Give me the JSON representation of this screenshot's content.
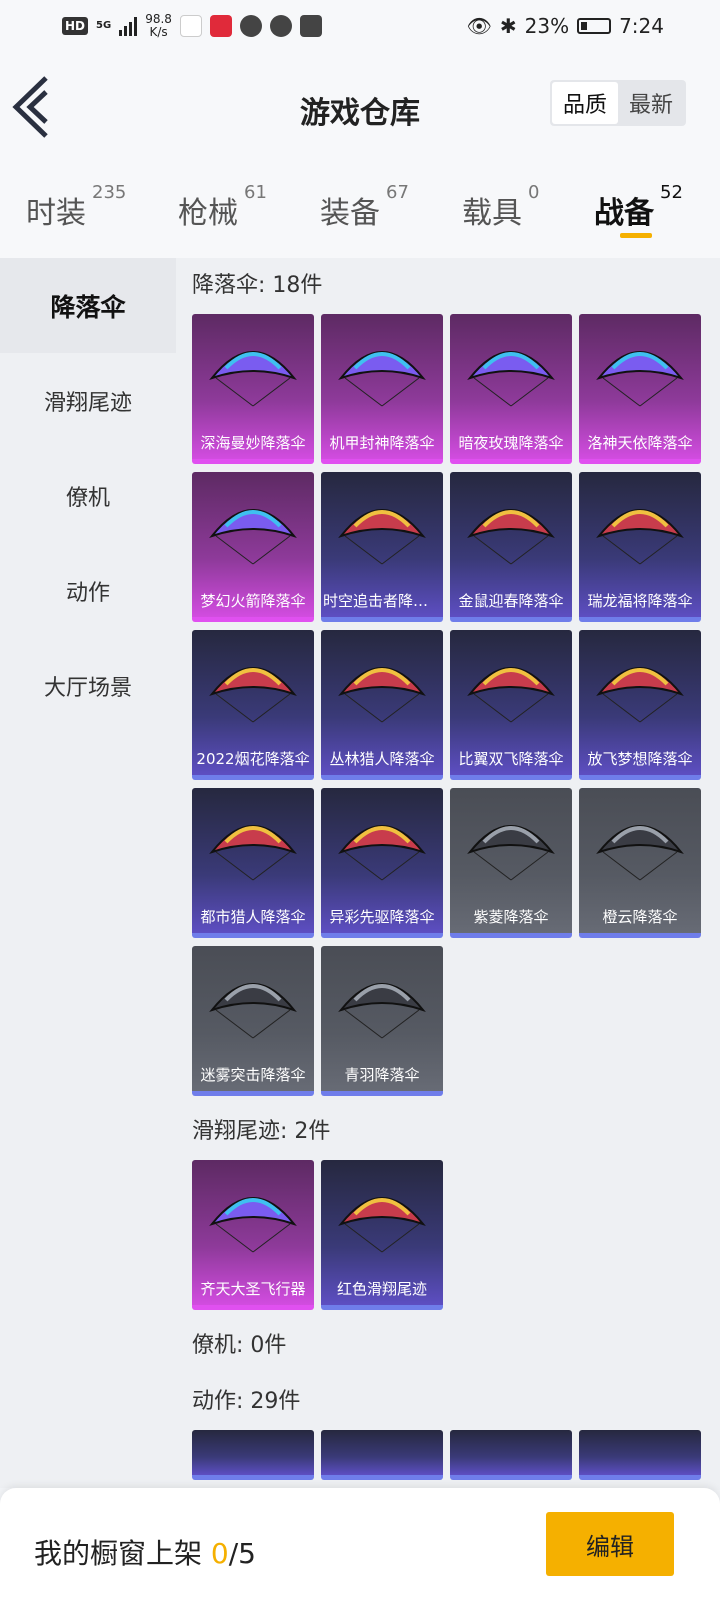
{
  "status_bar": {
    "hd": "HD",
    "network": "5G",
    "speed_value": "98.8",
    "speed_unit": "K/s",
    "battery": "23%",
    "time": "7:24"
  },
  "header": {
    "title": "游戏仓库",
    "sort_options": [
      "品质",
      "最新"
    ]
  },
  "tabs": [
    {
      "label": "时装",
      "count": "235"
    },
    {
      "label": "枪械",
      "count": "61"
    },
    {
      "label": "装备",
      "count": "67"
    },
    {
      "label": "载具",
      "count": "0"
    },
    {
      "label": "战备",
      "count": "52"
    }
  ],
  "sidebar": {
    "items": [
      "降落伞",
      "滑翔尾迹",
      "僚机",
      "动作",
      "大厅场景"
    ]
  },
  "sections": {
    "parachute": {
      "title": "降落伞: 18件",
      "items": [
        {
          "name": "深海曼妙降落伞",
          "rarity": "purple"
        },
        {
          "name": "机甲封神降落伞",
          "rarity": "purple"
        },
        {
          "name": "暗夜玫瑰降落伞",
          "rarity": "purple"
        },
        {
          "name": "洛神天依降落伞",
          "rarity": "purple"
        },
        {
          "name": "梦幻火箭降落伞",
          "rarity": "purple"
        },
        {
          "name": "时空追击者降落...",
          "rarity": "blue"
        },
        {
          "name": "金鼠迎春降落伞",
          "rarity": "blue"
        },
        {
          "name": "瑞龙福将降落伞",
          "rarity": "blue"
        },
        {
          "name": "2022烟花降落伞",
          "rarity": "blue"
        },
        {
          "name": "丛林猎人降落伞",
          "rarity": "blue"
        },
        {
          "name": "比翼双飞降落伞",
          "rarity": "blue"
        },
        {
          "name": "放飞梦想降落伞",
          "rarity": "blue"
        },
        {
          "name": "都市猎人降落伞",
          "rarity": "blue"
        },
        {
          "name": "异彩先驱降落伞",
          "rarity": "blue"
        },
        {
          "name": "紫菱降落伞",
          "rarity": "gray"
        },
        {
          "name": "橙云降落伞",
          "rarity": "gray"
        },
        {
          "name": "迷雾突击降落伞",
          "rarity": "gray"
        },
        {
          "name": "青羽降落伞",
          "rarity": "gray"
        }
      ]
    },
    "glide_trail": {
      "title": "滑翔尾迹: 2件",
      "items": [
        {
          "name": "齐天大圣飞行器",
          "rarity": "purple"
        },
        {
          "name": "红色滑翔尾迹",
          "rarity": "blue"
        }
      ]
    },
    "wingman": {
      "title": "僚机: 0件"
    },
    "emote": {
      "title": "动作: 29件"
    }
  },
  "bottom_bar": {
    "label": "我的橱窗上架",
    "count": "0",
    "total": "/5",
    "edit_label": "编辑"
  },
  "colors": {
    "accent": "#f5b000",
    "rarity_purple": "#e050f0",
    "rarity_blue": "#6f7dea"
  }
}
